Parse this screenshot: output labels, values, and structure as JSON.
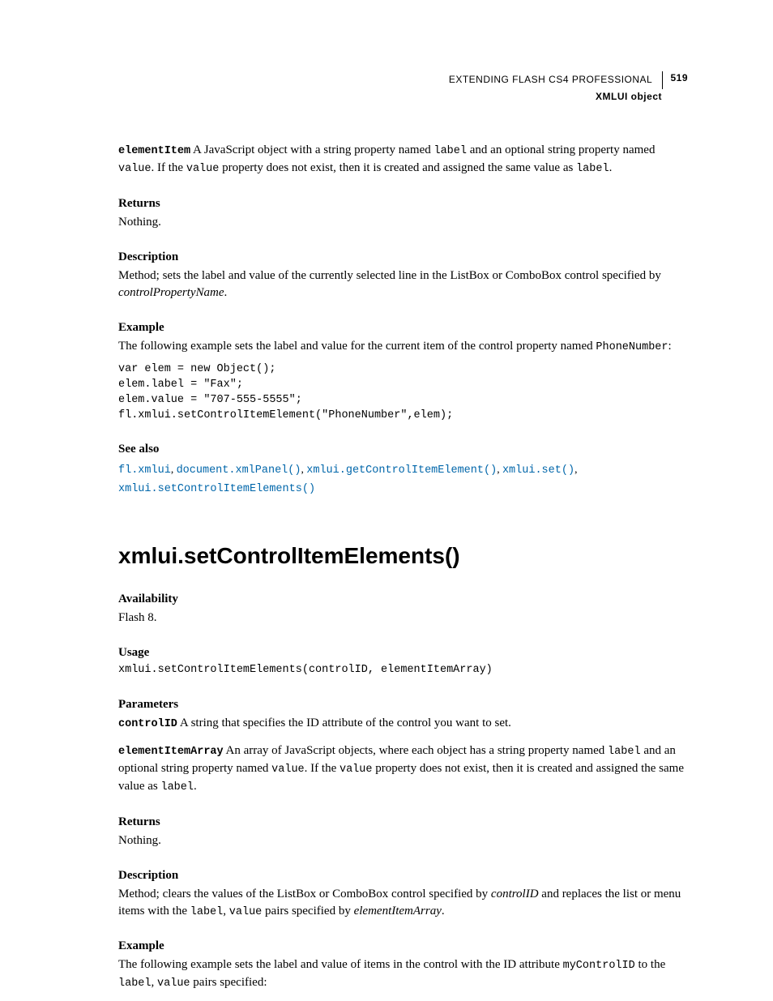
{
  "header": {
    "title": "EXTENDING FLASH CS4 PROFESSIONAL",
    "page_number": "519",
    "subtitle": "XMLUI object"
  },
  "sec1": {
    "elementItem_label": "elementItem",
    "elementItem_text_a": "  A JavaScript object with a string property named ",
    "label_code": "label",
    "elementItem_text_b": " and an optional string property named ",
    "value_code": "value",
    "elementItem_text_c": ". If the ",
    "elementItem_text_d": " property does not exist, then it is created and assigned the same value as ",
    "elementItem_text_e": ".",
    "returns_label": "Returns",
    "returns_text": "Nothing.",
    "description_label": "Description",
    "description_text_a": "Method; sets the label and value of the currently selected line in the ListBox or ComboBox control specified by ",
    "description_text_b": "controlPropertyName",
    "description_text_c": ".",
    "example_label": "Example",
    "example_text_a": "The following example sets the label and value for the current item of the control property named ",
    "example_code_a": "PhoneNumber",
    "example_text_b": ":",
    "code_block": "var elem = new Object(); \nelem.label = \"Fax\"; \nelem.value = \"707-555-5555\"; \nfl.xmlui.setControlItemElement(\"PhoneNumber\",elem);",
    "see_also_label": "See also",
    "links": {
      "l1": "fl.xmlui",
      "l2": "document.xmlPanel()",
      "l3": "xmlui.getControlItemElement()",
      "l4": "xmlui.set()",
      "l5": "xmlui.setControlItemElements()"
    }
  },
  "sec2": {
    "title": "xmlui.setControlItemElements()",
    "availability_label": "Availability",
    "availability_text": "Flash 8.",
    "usage_label": "Usage",
    "usage_code": "xmlui.setControlItemElements(controlID, elementItemArray)",
    "parameters_label": "Parameters",
    "controlID_label": "controlID",
    "controlID_text": "  A string that specifies the ID attribute of the control you want to set.",
    "elementItemArray_label": "elementItemArray",
    "eia_text_a": "  An array of JavaScript objects, where each object has a string property named ",
    "label_code": "label",
    "eia_text_b": " and an optional string property named ",
    "value_code": "value",
    "eia_text_c": ". If the ",
    "eia_text_d": " property does not exist, then it is created and assigned the same value as ",
    "eia_text_e": ".",
    "returns_label": "Returns",
    "returns_text": "Nothing.",
    "description_label": "Description",
    "desc_text_a": "Method; clears the values of the ListBox or ComboBox control specified by ",
    "desc_text_b": "controlID",
    "desc_text_c": " and replaces the list or menu items with the ",
    "desc_text_d": ", ",
    "desc_text_e": " pairs specified by ",
    "desc_text_f": "elementItemArray",
    "desc_text_g": ".",
    "example_label": "Example",
    "ex_text_a": "The following example sets the label and value of items in the control with the ID attribute ",
    "ex_code_a": "myControlID",
    "ex_text_b": " to the ",
    "ex_text_c": ", ",
    "ex_text_d": " pairs specified:"
  }
}
